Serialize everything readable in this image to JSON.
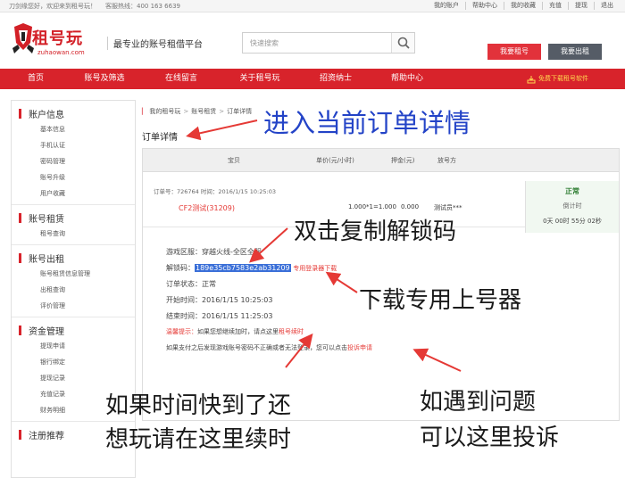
{
  "topbar": {
    "welcome": "刀剑缘您好，欢迎来到租号玩！",
    "hotline": "客服热线：400 163 6639",
    "links": [
      "我的账户",
      "帮助中心",
      "我的收藏",
      "充值",
      "提现",
      "退出"
    ]
  },
  "header": {
    "brand": "租号玩",
    "domain": "zuhaowan.com",
    "slogan": "最专业的账号租借平台",
    "search_placeholder": "快速搜索",
    "rent_button": "我要租号",
    "lend_button": "我要出租"
  },
  "nav": {
    "items": [
      "首页",
      "账号及筛选",
      "在线留言",
      "关于租号玩",
      "招资纳士",
      "帮助中心"
    ],
    "download": "免费下载租号软件"
  },
  "sidebar": {
    "sections": [
      {
        "title": "账户信息",
        "items": [
          "基本信息",
          "手机认证",
          "密码管理",
          "账号升级",
          "用户收藏"
        ]
      },
      {
        "title": "账号租赁",
        "items": [
          "租号查询"
        ]
      },
      {
        "title": "账号出租",
        "items": [
          "账号租赁信息管理",
          "出租查询",
          "评价管理"
        ]
      },
      {
        "title": "资金管理",
        "items": [
          "提现申请",
          "银行绑定",
          "提现记录",
          "充值记录",
          "财务明细"
        ]
      },
      {
        "title": "注册推荐",
        "items": []
      }
    ]
  },
  "main": {
    "breadcrumb": [
      "我的租号玩",
      "账号租赁",
      "订单详情"
    ],
    "page_title": "订单详情",
    "table_headers": [
      "宝贝",
      "单价(元/小时)",
      "押金(元)",
      "放号方"
    ],
    "order": {
      "meta": "订单号：726764  时间：2016/1/15 10:25:03",
      "game": "CF2测试(31209)",
      "price": "1.000*1=1.000",
      "deposit": "0.000",
      "renter": "测试员***",
      "status": "正常",
      "countdown_label": "倒计时",
      "countdown": "0天 00时 55分 02秒"
    },
    "details": {
      "server": "游戏区服：穿越火线-全区全服",
      "code_label": "解锁码：",
      "code": "189e35cb7583e2ab31209",
      "code_link": "专用登录器下载",
      "status": "订单状态：正常",
      "start": "开始时间：2016/1/15 10:25:03",
      "end": "结束时间：2016/1/15 11:25:03",
      "tip_prefix": "温馨提示：",
      "tip_text": "如果您想继续加时，请点这里",
      "tip_link": "租号续时",
      "complain_text": "如果支付之后发现游戏账号密码不正确或者无法登录，您可以点击",
      "complain_link": "投诉申请"
    }
  },
  "annotations": {
    "enter_detail": "进入当前订单详情",
    "double_click": "双击复制解锁码",
    "download_tool": "下载专用上号器",
    "renew_line1": "如果时间快到了还",
    "renew_line2": "想玩请在这里续时",
    "complain_line1": "如遇到问题",
    "complain_line2": "可以这里投诉"
  },
  "colors": {
    "brand_red": "#d8232b",
    "annotation_blue": "#2343c7",
    "code_highlight": "#3a6fd8"
  }
}
